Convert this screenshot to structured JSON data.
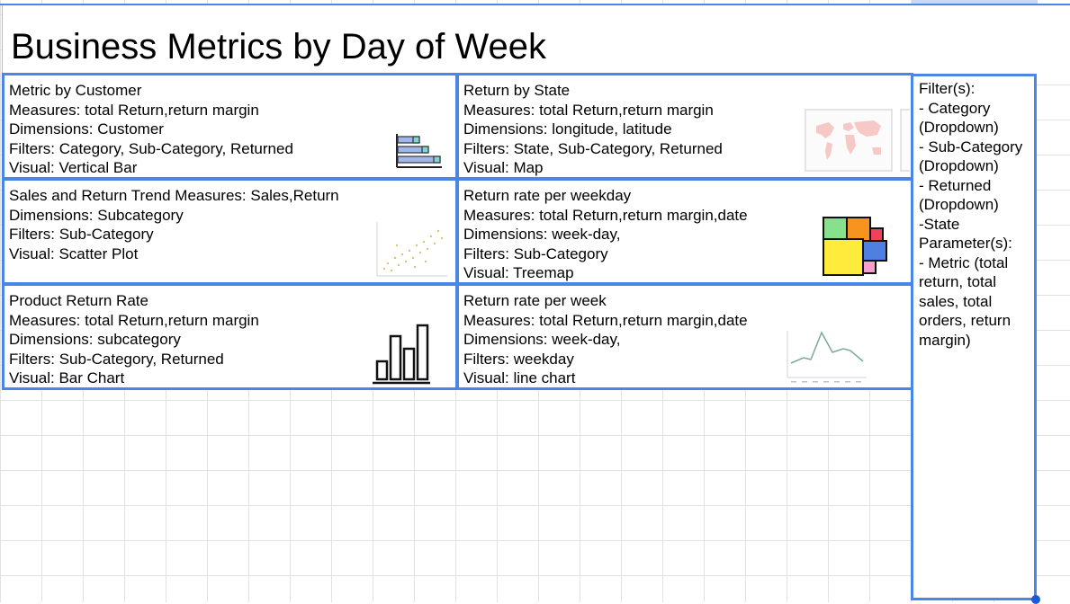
{
  "title": "Business Metrics by Day of Week",
  "cards": [
    {
      "title": "Metric by Customer",
      "measures": "Measures: total Return,return margin",
      "dimensions": "Dimensions: Customer",
      "filters": "Filters: Category, Sub-Category, Returned",
      "visual": "Visual: Vertical Bar",
      "icon": "horizontal-bar-icon"
    },
    {
      "title": "Return by State",
      "measures": "Measures: total Return,return margin",
      "dimensions": "Dimensions: longitude, latitude",
      "filters": "Filters: State, Sub-Category, Returned",
      "visual": "Visual: Map",
      "icon": "world-map-icon"
    },
    {
      "title": "Sales and Return Trend Measures: Sales,Return",
      "dimensions": "Dimensions: Subcategory",
      "filters": "Filters: Sub-Category",
      "visual": "Visual: Scatter Plot",
      "icon": "scatter-plot-icon"
    },
    {
      "title": "Return rate per weekday",
      "measures": "Measures: total Return,return margin,date",
      "dimensions": "Dimensions: week-day,",
      "filters": "Filters: Sub-Category",
      "visual": "Visual: Treemap",
      "icon": "treemap-icon"
    },
    {
      "title": "Product Return Rate",
      "measures": "Measures: total Return,return margin",
      "dimensions": "Dimensions: subcategory",
      "filters": "Filters:  Sub-Category, Returned",
      "visual": "Visual: Bar Chart",
      "icon": "bar-chart-icon"
    },
    {
      "title": "Return rate per week",
      "measures": "Measures: total Return,return margin,date",
      "dimensions": "Dimensions: week-day,",
      "filters": "Filters: weekday",
      "visual": "Visual: line chart",
      "icon": "line-chart-icon"
    }
  ],
  "sidebar": {
    "lines": [
      "Filter(s):",
      "- Category",
      "(Dropdown)",
      "- Sub-Category",
      "(Dropdown)",
      "- Returned",
      "(Dropdown)",
      "-State",
      "Parameter(s):",
      "- Metric (total",
      "return, total",
      "sales, total",
      "orders, return",
      "margin)"
    ]
  },
  "colors": {
    "selection_border": "#4a86e8",
    "grid": "#e2e2e2",
    "treemap": [
      "#ffeb3b",
      "#86e08c",
      "#f7941d",
      "#4f7fe0",
      "#f04060",
      "#f5a0d0"
    ]
  }
}
